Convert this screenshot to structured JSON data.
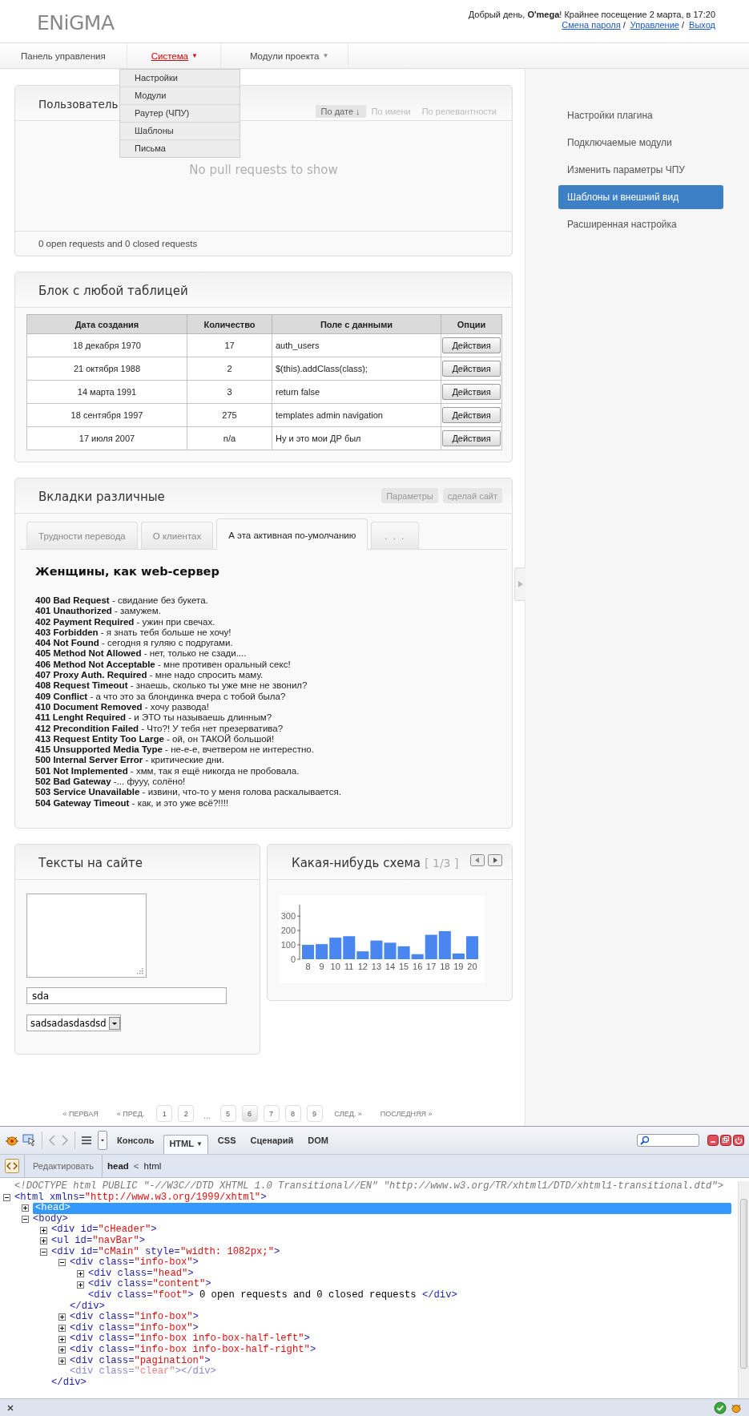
{
  "header": {
    "logo": "ENiGMA",
    "greeting": "Добрый день, **O'mega**! Крайнее посещение 2 марта, в 17:20",
    "links": [
      "Смена пароля",
      "Управление",
      "Выход"
    ],
    "separators": [
      "/",
      "/"
    ]
  },
  "nav": [
    {
      "label": "Панель управления",
      "selected": false
    },
    {
      "label": "Система",
      "selected": true,
      "caret": "▼"
    },
    {
      "label": "Модули проекта",
      "selected": false,
      "caret": "▼"
    }
  ],
  "dropdown": {
    "items": [
      "Настройки",
      "Модули",
      "Раутер (ЧПУ)",
      "Шаблоны",
      "Письма"
    ]
  },
  "sidebar": {
    "items": [
      {
        "label": "Настройки плагина",
        "selected": false
      },
      {
        "label": "Подключаемые модули",
        "selected": false
      },
      {
        "label": "Изменить параметры ЧПУ",
        "selected": false
      },
      {
        "label": "Шаблоны и внешний вид",
        "selected": true
      },
      {
        "label": "Расширенная настройка",
        "selected": false
      }
    ]
  },
  "pull_requests": {
    "title": "Пользователь",
    "sort_tabs": [
      {
        "label": "По дате ↓",
        "selected": true
      },
      {
        "label": "По имени",
        "selected": false
      },
      {
        "label": "По релевантности",
        "selected": false
      }
    ],
    "empty_message": "No pull requests to show",
    "footer": "0 open requests and 0 closed requests"
  },
  "table_block": {
    "title": "Блок с любой таблицей",
    "columns": [
      "Дата создания",
      "Количество",
      "Поле с данными",
      "Опции"
    ],
    "rows": [
      {
        "cells": [
          "18 декабря 1970",
          "17",
          "auth_users"
        ],
        "action": "Действия"
      },
      {
        "cells": [
          "21 октября 1988",
          "2",
          "$(this).addClass(class);"
        ],
        "action": "Действия"
      },
      {
        "cells": [
          "14 марта 1991",
          "3",
          "return false"
        ],
        "action": "Действия"
      },
      {
        "cells": [
          "18 сентября 1997",
          "275",
          "templates admin navigation"
        ],
        "action": "Действия"
      },
      {
        "cells": [
          "17 июля 2007",
          "n/a",
          "Ну и это мои ДР был"
        ],
        "action": "Действия"
      }
    ]
  },
  "tabs_block": {
    "title": "Вкладки различные",
    "buttons": [
      "Параметры",
      "сделай сайт"
    ],
    "tabs": [
      {
        "label": "Трудности перевода",
        "selected": false
      },
      {
        "label": "О клиентах",
        "selected": false
      },
      {
        "label": "А эта активная по-умолчанию",
        "selected": true
      },
      {
        "label": ". . .",
        "selected": false
      }
    ],
    "heading": "Женщины, как web-сервер",
    "lines": [
      "**400 Bad Request** - свидание без букета.",
      "**401 Unauthorized** - замужем.",
      "**402 Payment Required** - ужин при свечах.",
      "**403 Forbidden** - я знать тебя больше не хочу!",
      "**404 Not Found** - сегодня я гуляю с подругами.",
      "**405 Method Not Allowed** - нет, только не сзади....",
      "**406 Method Not Acceptable** - мне противен оральный секс!",
      "**407 Proxy Auth. Required** - мне надо спросить маму.",
      "**408 Request Timeout** - знаешь, сколько ты уже мне не звонил?",
      "**409 Conflict** - а что это за блондинка вчера с тобой была?",
      "**410 Document Removed** - хочу развода!",
      "**411 Lenght Required** - и ЭТО ты называешь длинным?",
      "**412 Precondition Failed** - Что?! У тебя нет презерватива?",
      "**413 Request Entity Too Large** - ой, он ТАКОЙ большой!",
      "**415 Unsupported Media Type** - не-е-е, вчетвером не интерестно.",
      "**500 Internal Server Error** - критические дни.",
      "**501 Not Implemented** - хмм, так я ещё никогда не пробовала.",
      "**502 Bad Gateway** -... фууу, солёно!",
      "**503 Service Unavailable** - извини, что-то у меня голова раскалывается.",
      "**504 Gateway Timeout** - как, и это уже всё?!!!!"
    ]
  },
  "texts_block": {
    "title": "Тексты на сайте",
    "input_value": "sda",
    "select_value": "sadsadasdasdsd"
  },
  "chart_block": {
    "title": "Какая-нибудь схема",
    "pager": "[ 1/3 ]",
    "chart_data": {
      "type": "bar",
      "categories": [
        "8",
        "9",
        "10",
        "11",
        "12",
        "13",
        "14",
        "15",
        "16",
        "17",
        "18",
        "19",
        "20"
      ],
      "series": [
        {
          "color": "#4a86f0",
          "values": [
            100,
            105,
            150,
            160,
            55,
            130,
            115,
            90,
            35,
            170,
            195,
            40,
            160
          ]
        }
      ],
      "ylim": [
        0,
        390
      ],
      "yticks": [
        0,
        100,
        200,
        300
      ]
    }
  },
  "pagination": [
    {
      "kind": "link",
      "label": "« ПЕРВАЯ"
    },
    {
      "kind": "link",
      "label": "« ПРЕД."
    },
    {
      "kind": "page",
      "label": "1",
      "selected": false
    },
    {
      "kind": "page",
      "label": "2",
      "selected": false
    },
    {
      "kind": "gap",
      "label": "..."
    },
    {
      "kind": "page",
      "label": "5",
      "selected": false
    },
    {
      "kind": "page",
      "label": "6",
      "selected": true
    },
    {
      "kind": "page",
      "label": "7",
      "selected": false
    },
    {
      "kind": "page",
      "label": "8",
      "selected": false
    },
    {
      "kind": "page",
      "label": "9",
      "selected": false
    },
    {
      "kind": "link",
      "label": "СЛЕД. »"
    },
    {
      "kind": "link",
      "label": "ПОСЛЕДНЯЯ »"
    }
  ],
  "firebug": {
    "tabs": [
      {
        "label": "Консоль",
        "selected": false
      },
      {
        "label": "HTML",
        "selected": true,
        "caret": "▼"
      },
      {
        "label": "CSS",
        "selected": false
      },
      {
        "label": "Сценарий",
        "selected": false
      },
      {
        "label": "DOM",
        "selected": false
      }
    ],
    "edit_button": "Редактировать",
    "breadcrumb": [
      {
        "label": "head",
        "selected": true
      },
      {
        "label": "html",
        "selected": false
      }
    ],
    "breadcrumb_separator": "<",
    "tree": [
      {
        "kind": "doctype",
        "selected": false,
        "text": "<!DOCTYPE html PUBLIC \"-//W3C//DTD XHTML 1.0 Transitional//EN\" \"http://www.w3.org/TR/xhtml1/DTD/xhtml1-transitional.dtd\">"
      },
      {
        "kind": "toggle",
        "expanded": true,
        "selected": false,
        "text": "<html xmlns=\"http://www.w3.org/1999/xhtml\">",
        "children": [
          {
            "kind": "toggle",
            "expanded": false,
            "selected": true,
            "text": "<head>"
          },
          {
            "kind": "toggle",
            "expanded": true,
            "selected": false,
            "text": "<body>",
            "children": [
              {
                "kind": "toggle",
                "expanded": false,
                "selected": false,
                "text": "<div id=\"cHeader\">"
              },
              {
                "kind": "toggle",
                "expanded": false,
                "selected": false,
                "text": "<ul id=\"navBar\">"
              },
              {
                "kind": "toggle",
                "expanded": true,
                "selected": false,
                "text": "<div id=\"cMain\" style=\"width: 1082px;\">",
                "close": "</div>",
                "children": [
                  {
                    "kind": "toggle",
                    "expanded": true,
                    "selected": false,
                    "text": "<div class=\"info-box\">",
                    "close": "</div>",
                    "children": [
                      {
                        "kind": "toggle",
                        "expanded": false,
                        "selected": false,
                        "text": "<div class=\"head\">"
                      },
                      {
                        "kind": "toggle",
                        "expanded": false,
                        "selected": false,
                        "text": "<div class=\"content\">"
                      },
                      {
                        "kind": "leaf",
                        "selected": false,
                        "text": "<div class=\"foot\"> 0 open requests and 0 closed requests </div>"
                      }
                    ]
                  },
                  {
                    "kind": "toggle",
                    "expanded": false,
                    "selected": false,
                    "text": "<div class=\"info-box\">"
                  },
                  {
                    "kind": "toggle",
                    "expanded": false,
                    "selected": false,
                    "text": "<div class=\"info-box\">"
                  },
                  {
                    "kind": "toggle",
                    "expanded": false,
                    "selected": false,
                    "text": "<div class=\"info-box info-box-half-left\">"
                  },
                  {
                    "kind": "toggle",
                    "expanded": false,
                    "selected": false,
                    "text": "<div class=\"info-box info-box-half-right\">"
                  },
                  {
                    "kind": "toggle",
                    "expanded": false,
                    "selected": false,
                    "text": "<div class=\"pagination\">"
                  },
                  {
                    "kind": "leaf",
                    "selected": false,
                    "hidden": true,
                    "text": "<div class=\"clear\"></div>"
                  }
                ]
              }
            ]
          }
        ]
      }
    ]
  }
}
